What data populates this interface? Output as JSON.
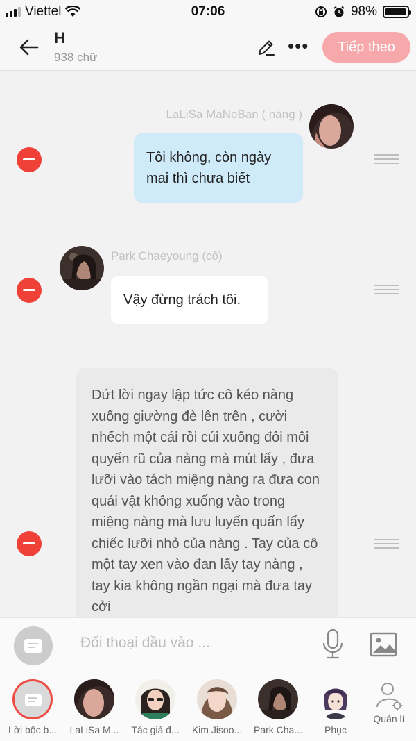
{
  "status_bar": {
    "carrier": "Viettel",
    "time": "07:06",
    "battery": "98%"
  },
  "header": {
    "title": "H",
    "subtitle": "938 chữ",
    "next_button": "Tiếp theo"
  },
  "messages": [
    {
      "speaker": "LaLiSa MaNoBan ( nàng )",
      "text": "Tôi không, còn ngày mai thì chưa biết",
      "style": "right-blue"
    },
    {
      "speaker": "Park Chaeyoung (cô)",
      "text": "Vậy đừng trách tôi.",
      "style": "left-white"
    },
    {
      "speaker": "",
      "text": "Dứt lời ngay lập tức cô kéo nàng xuống giường đè lên trên , cười nhếch một cái rồi cúi xuống đôi môi quyến rũ của nàng mà mút lấy , đưa lưỡi vào tách miệng nàng ra đưa con quái vật không xuống vào trong miệng nàng mà lưu luyến quấn lấy chiếc lưỡi nhỏ của nàng . Tay của cô một tay xen vào đan lấy tay nàng , tay kia không ngần ngại mà đưa tay cởi",
      "style": "narration"
    }
  ],
  "input": {
    "placeholder": "Đối thoại đầu vào ..."
  },
  "characters": [
    {
      "label": "Lời bộc b...",
      "active": true
    },
    {
      "label": "LaLiSa M..."
    },
    {
      "label": "Tác giả đ..."
    },
    {
      "label": "Kim Jisoo..."
    },
    {
      "label": "Park Cha..."
    },
    {
      "label": "Phục"
    },
    {
      "label": "Quản lí"
    }
  ],
  "colors": {
    "accent": "#f7a8ab",
    "delete": "#ef4138",
    "bubble_blue": "#cfeaf9"
  }
}
